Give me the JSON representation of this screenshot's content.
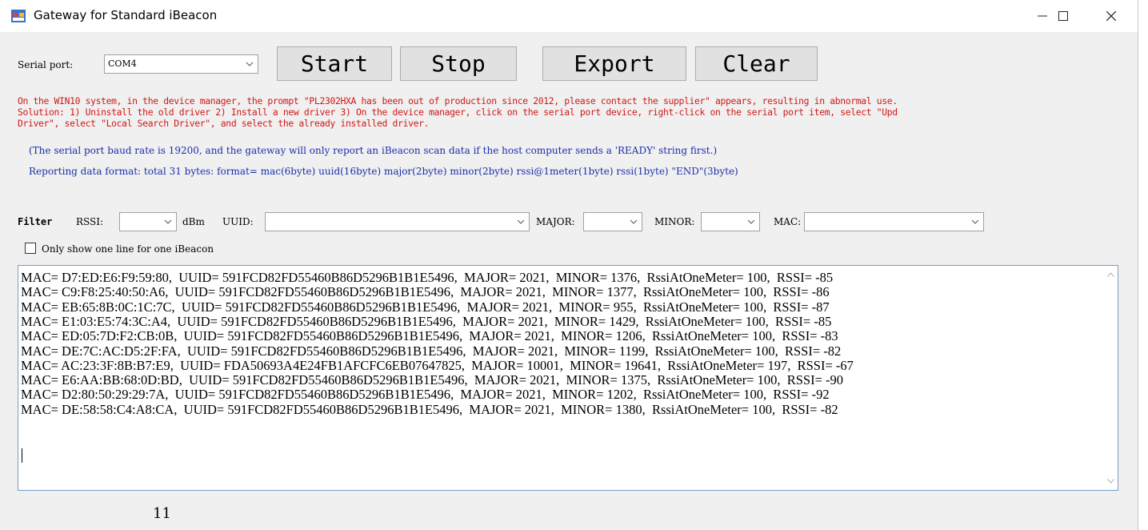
{
  "window": {
    "title": "Gateway for Standard iBeacon",
    "minimize": "—",
    "maximize": "☐",
    "close": "✕"
  },
  "serial": {
    "label": "Serial port:",
    "value": "COM4"
  },
  "buttons": {
    "start": "Start",
    "stop": "Stop",
    "export": "Export",
    "clear": "Clear"
  },
  "notes": {
    "red_line1": "On the WIN10 system, in the device manager, the prompt \"PL2302HXA has been out of production since 2012, please contact the supplier\" appears, resulting in abnormal use.",
    "red_line2": "Solution: 1) Uninstall the old driver 2) Install a new driver 3) On the device manager, click on the serial port device, right-click on the serial port item, select \"Upd",
    "red_line3": "Driver\", select \"Local Search Driver\", and select the already installed driver.",
    "blue_line1": "(The serial port baud rate is 19200, and the gateway will only report an iBeacon scan data if the host computer sends a 'READY' string first.)",
    "blue_line2": "Reporting data format: total 31 bytes: format= mac(6byte) uuid(16byte) major(2byte) minor(2byte) rssi@1meter(1byte) rssi(1byte) \"END\"(3byte)"
  },
  "filter": {
    "title": "Filter",
    "rssi_label": "RSSI:",
    "rssi_value": "",
    "unit": "dBm",
    "uuid_label": "UUID:",
    "uuid_value": "",
    "major_label": "MAJOR:",
    "major_value": "",
    "minor_label": "MINOR:",
    "minor_value": "",
    "mac_label": "MAC:",
    "mac_value": ""
  },
  "only_one_line": {
    "label": "Only show one line for one iBeacon",
    "checked": false
  },
  "log": [
    "MAC= D7:ED:E6:F9:59:80,  UUID= 591FCD82FD55460B86D5296B1B1E5496,  MAJOR= 2021,  MINOR= 1376,  RssiAtOneMeter= 100,  RSSI= -85",
    "MAC= C9:F8:25:40:50:A6,  UUID= 591FCD82FD55460B86D5296B1B1E5496,  MAJOR= 2021,  MINOR= 1377,  RssiAtOneMeter= 100,  RSSI= -86",
    "MAC= EB:65:8B:0C:1C:7C,  UUID= 591FCD82FD55460B86D5296B1B1E5496,  MAJOR= 2021,  MINOR= 955,  RssiAtOneMeter= 100,  RSSI= -87",
    "MAC= E1:03:E5:74:3C:A4,  UUID= 591FCD82FD55460B86D5296B1B1E5496,  MAJOR= 2021,  MINOR= 1429,  RssiAtOneMeter= 100,  RSSI= -85",
    "MAC= ED:05:7D:F2:CB:0B,  UUID= 591FCD82FD55460B86D5296B1B1E5496,  MAJOR= 2021,  MINOR= 1206,  RssiAtOneMeter= 100,  RSSI= -83",
    "MAC= DE:7C:AC:D5:2F:FA,  UUID= 591FCD82FD55460B86D5296B1B1E5496,  MAJOR= 2021,  MINOR= 1199,  RssiAtOneMeter= 100,  RSSI= -82",
    "MAC= AC:23:3F:8B:B7:E9,  UUID= FDA50693A4E24FB1AFCFC6EB07647825,  MAJOR= 10001,  MINOR= 19641,  RssiAtOneMeter= 197,  RSSI= -67",
    "MAC= E6:AA:BB:68:0D:BD,  UUID= 591FCD82FD55460B86D5296B1B1E5496,  MAJOR= 2021,  MINOR= 1375,  RssiAtOneMeter= 100,  RSSI= -90",
    "MAC= D2:80:50:29:29:7A,  UUID= 591FCD82FD55460B86D5296B1B1E5496,  MAJOR= 2021,  MINOR= 1202,  RssiAtOneMeter= 100,  RSSI= -92",
    "MAC= DE:58:58:C4:A8:CA,  UUID= 591FCD82FD55460B86D5296B1B1E5496,  MAJOR= 2021,  MINOR= 1380,  RssiAtOneMeter= 100,  RSSI= -82"
  ],
  "count": "11",
  "colors": {
    "warning_text": "#d01818",
    "info_text": "#1a2fa8",
    "log_border": "#7a9cc6"
  }
}
